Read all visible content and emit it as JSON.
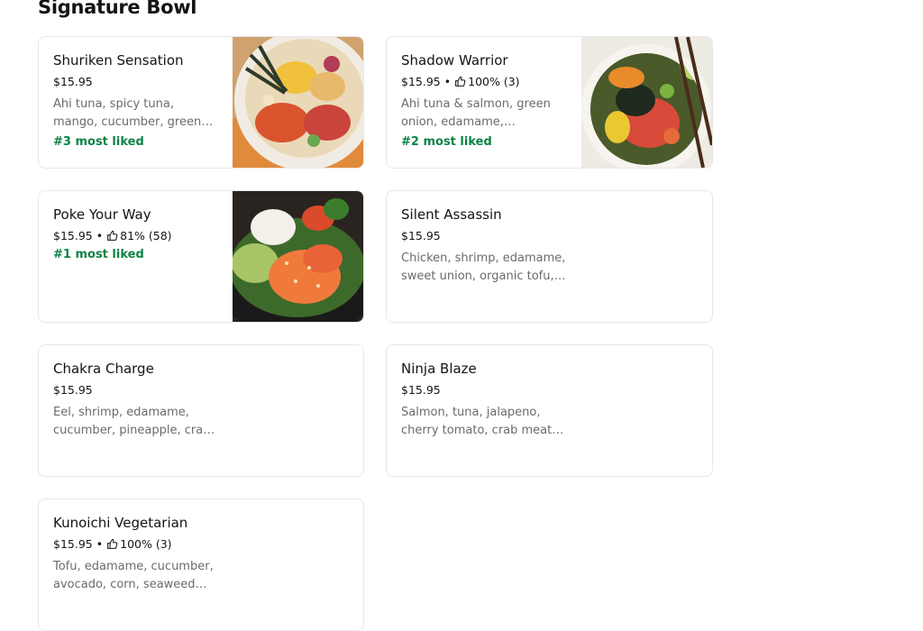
{
  "section": {
    "title": "Signature Bowl"
  },
  "items": [
    {
      "name": "Shuriken Sensation",
      "price": "$15.95",
      "rating": "",
      "description": "Ahi tuna, spicy tuna, mango, cucumber, green onion, crab meat, masago",
      "badge": "#3 most liked",
      "image": "shuriken-bowl-photo"
    },
    {
      "name": "Shadow Warrior",
      "price": "$15.95",
      "rating": "100% (3)",
      "description": "Ahi tuna & salmon, green onion, edamame, cucumber, seaweed salad",
      "badge": "#2 most liked",
      "image": "shadow-warrior-bowl-photo"
    },
    {
      "name": "Poke Your Way",
      "price": "$15.95",
      "rating": "81% (58)",
      "description": "",
      "badge": "#1 most liked",
      "image": "poke-your-way-bowl-photo"
    },
    {
      "name": "Silent Assassin",
      "price": "$15.95",
      "rating": "",
      "description": "Chicken, shrimp, edamame, sweet union, organic tofu, corn, cucumber",
      "badge": "",
      "image": ""
    },
    {
      "name": "Chakra Charge",
      "price": "$15.95",
      "rating": "",
      "description": "Eel, shrimp, edamame, cucumber, pineapple, crab meat, avocado",
      "badge": "",
      "image": ""
    },
    {
      "name": "Ninja Blaze",
      "price": "$15.95",
      "rating": "",
      "description": "Salmon, tuna, jalapeno, cherry tomato, crab meat, spicy mayo",
      "badge": "",
      "image": ""
    },
    {
      "name": "Kunoichi Vegetarian",
      "price": "$15.95",
      "rating": "100% (3)",
      "description": "Tofu, edamame, cucumber, avocado, corn, seaweed salad",
      "badge": "",
      "image": ""
    }
  ],
  "meta_separator": "•",
  "icons": {
    "rating": "thumbs-up-icon"
  },
  "colors": {
    "badge": "#0e8345",
    "description": "#6b6b6b",
    "border": "#e8e8e8"
  }
}
